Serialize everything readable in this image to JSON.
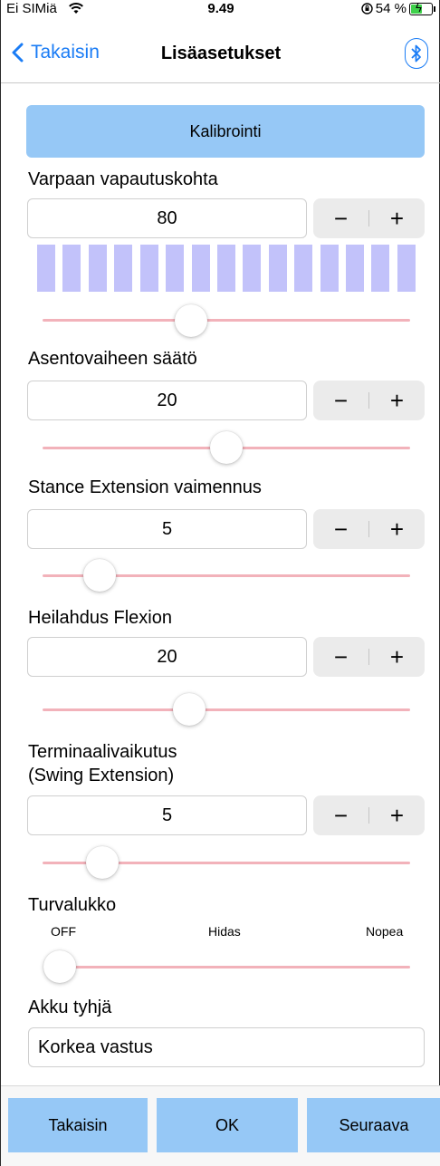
{
  "status_bar": {
    "carrier": "Ei SIMiä",
    "time": "9.49",
    "battery": "54 %",
    "battery_level": 0.54
  },
  "nav": {
    "back_label": "Takaisin",
    "title": "Lisäasetukset"
  },
  "calibration_button": "Kalibrointi",
  "toe_release": {
    "label": "Varpaan vapautuskohta",
    "value": "80",
    "minus": "−",
    "plus": "+",
    "bar_count": 15
  },
  "stance_phase": {
    "label": "Asentovaihe­en säätö",
    "value": "20",
    "minus": "−",
    "plus": "+"
  },
  "stance_extension": {
    "label": "Stance Extension vaimennus",
    "value": "5",
    "minus": "−",
    "plus": "+"
  },
  "swing_flexion": {
    "label": "Heilahdus Flexion",
    "value": "20",
    "minus": "−",
    "plus": "+"
  },
  "terminal_impact": {
    "label_line1": "Terminaalivaikutus",
    "label_line2": "(Swing Extension)",
    "value": "5",
    "minus": "−",
    "plus": "+"
  },
  "safety_lock": {
    "label": "Turvalukko",
    "options": [
      "OFF",
      "Hidas",
      "Nopea"
    ],
    "selected": "OFF"
  },
  "low_battery": {
    "label": "Akku tyhjä",
    "value": "Korkea vastus"
  },
  "footer": {
    "back": "Takaisin",
    "ok": "OK",
    "next": "Seuraava"
  },
  "colors": {
    "accent": "#1a7cf5",
    "button": "#96c8f6",
    "slider_track": "#f2b2ba",
    "bars": "#c2c2fa"
  }
}
